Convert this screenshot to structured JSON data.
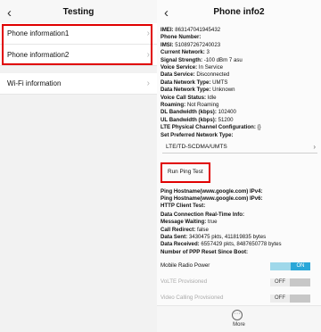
{
  "left": {
    "title": "Testing",
    "items": [
      {
        "label": "Phone information1"
      },
      {
        "label": "Phone information2"
      },
      {
        "label": "Wi-Fi information"
      }
    ]
  },
  "right": {
    "title": "Phone info2",
    "info": [
      {
        "k": "IMEI:",
        "v": "863147041945432",
        "bold": true
      },
      {
        "k": "Phone Number:",
        "v": "",
        "bold": true
      },
      {
        "k": "IMSI:",
        "v": "510897267240023",
        "bold": true
      },
      {
        "k": "Current Network:",
        "v": "3",
        "bold": true
      },
      {
        "k": "Signal Strength:",
        "v": "-100 dBm   7 asu",
        "bold": true
      },
      {
        "k": "Voice Service:",
        "v": "In Service",
        "bold": true
      },
      {
        "k": "Data Service:",
        "v": "Disconnected",
        "bold": true
      },
      {
        "k": "Data Network Type:",
        "v": "UMTS",
        "bold": true
      },
      {
        "k": "Data Network Type:",
        "v": "Unknown",
        "bold": true
      },
      {
        "k": "Voice Call Status:",
        "v": "Idle",
        "bold": true
      },
      {
        "k": "Roaming:",
        "v": "Not Roaming",
        "bold": true
      },
      {
        "k": "DL Bandwidth (kbps):",
        "v": "102400",
        "bold": true
      },
      {
        "k": "UL Bandwidth (kbps):",
        "v": "51200",
        "bold": true
      },
      {
        "k": "LTE Physical Channel Configuration:",
        "v": "{}",
        "bold": true
      },
      {
        "k": "Set Preferred Network Type:",
        "v": "",
        "bold": true
      }
    ],
    "preferred_network": "LTE/TD-SCDMA/UMTS",
    "ping_button": "Run Ping Test",
    "ping": [
      {
        "k": "Ping Hostname(www.google.com) IPv4:",
        "v": ""
      },
      {
        "k": "Ping Hostname(www.google.com) IPv6:",
        "v": ""
      },
      {
        "k": "HTTP Client Test:",
        "v": ""
      }
    ],
    "data_conn": [
      {
        "k": "Data Connection Real-Time Info:",
        "v": ""
      },
      {
        "k": "Message Waiting:",
        "v": "true"
      },
      {
        "k": "Call Redirect:",
        "v": "false"
      },
      {
        "k": "Data Sent:",
        "v": "3430475 pkts, 411819835 bytes"
      },
      {
        "k": "Data Received:",
        "v": "6557429 pkts, 8487650778 bytes"
      },
      {
        "k": "Number of PPP Reset Since Boot:",
        "v": ""
      }
    ],
    "toggles": [
      {
        "label": "Mobile Radio Power",
        "state": "ON",
        "disabled": false
      },
      {
        "label": "VoLTE Provisioned",
        "state": "OFF",
        "disabled": true
      },
      {
        "label": "Video Calling Provisioned",
        "state": "OFF",
        "disabled": true
      }
    ],
    "more_label": "More"
  },
  "icons": {
    "back": "back-arrow-icon",
    "chevron": "chevron-right-icon",
    "more": "more-icon"
  },
  "colors": {
    "highlight": "#e00000",
    "toggle_on": "#2aa7d8"
  }
}
